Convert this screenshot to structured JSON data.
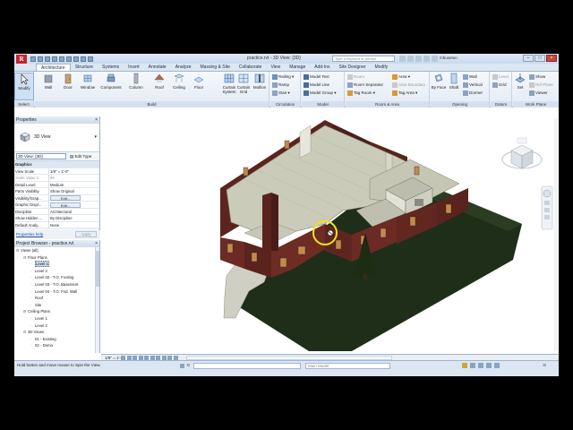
{
  "window": {
    "title": "practice.rvt - 3D View: {3D}",
    "search_placeholder": "Type a keyword or phrase",
    "user": "mhuseton",
    "app_logo": "R"
  },
  "ribbon_tabs": [
    "Architecture",
    "Structure",
    "Systems",
    "Insert",
    "Annotate",
    "Analyze",
    "Massing & Site",
    "Collaborate",
    "View",
    "Manage",
    "Add-Ins",
    "Site Designer",
    "Modify"
  ],
  "ribbon": {
    "modify": "Modify",
    "select_label": "Select",
    "build": [
      "Wall",
      "Door",
      "Window",
      "Component",
      "Column",
      "Roof",
      "Ceiling",
      "Floor"
    ],
    "curtain_system": "Curtain System",
    "curtain_grid": "Curtain Grid",
    "mullion": "Mullion",
    "build_label": "Build",
    "circulation": [
      "Railing",
      "Ramp",
      "Stair"
    ],
    "circulation_label": "Circulation",
    "model": [
      "Model Text",
      "Model Line",
      "Model Group"
    ],
    "model_label": "Model",
    "room": [
      "Room",
      "Room Separator",
      "Tag Room"
    ],
    "area": [
      "Area",
      "Area Boundary",
      "Tag Area"
    ],
    "room_label": "Room & Area",
    "opening_big": [
      "By Face",
      "Shaft"
    ],
    "opening_small": [
      "Wall",
      "Vertical",
      "Dormer"
    ],
    "opening_label": "Opening",
    "datum": [
      "Level",
      "Grid"
    ],
    "datum_label": "Datum",
    "set": "Set",
    "workplane_small": [
      "Show",
      "Ref Plane",
      "Viewer"
    ],
    "workplane_label": "Work Plane"
  },
  "properties": {
    "title": "Properties",
    "type_name": "3D View",
    "instance": "3D View: {3D}",
    "edit_type": "Edit Type",
    "rows": [
      {
        "k": "Graphics",
        "v": "",
        "cat": true
      },
      {
        "k": "View Scale",
        "v": "1/8\" = 1'-0\""
      },
      {
        "k": "Scale Value 1:",
        "v": "96",
        "dim": true
      },
      {
        "k": "Detail Level",
        "v": "Medium"
      },
      {
        "k": "Parts Visibility",
        "v": "Show Original"
      },
      {
        "k": "Visibility/Grap...",
        "v": "Edit...",
        "btn": true
      },
      {
        "k": "Graphic Displ...",
        "v": "Edit...",
        "btn": true
      },
      {
        "k": "Discipline",
        "v": "Architectural"
      },
      {
        "k": "Show Hidden ...",
        "v": "By Discipline"
      },
      {
        "k": "Default Analy...",
        "v": "None"
      }
    ],
    "help": "Properties help",
    "apply": "Apply"
  },
  "browser": {
    "title": "Project Browser - practice.rvt",
    "items": [
      {
        "t": "Views (all)",
        "lvl": 0,
        "tg": "⊟"
      },
      {
        "t": "Floor Plans",
        "lvl": 1,
        "tg": "⊟"
      },
      {
        "t": "Level 1",
        "lvl": 2,
        "sel": true
      },
      {
        "t": "Level 2",
        "lvl": 2
      },
      {
        "t": "Level 02 - T.O. Footing",
        "lvl": 2
      },
      {
        "t": "Level 03 - T.O. Basement",
        "lvl": 2
      },
      {
        "t": "Level 04 - T.O. Fnd. Wall",
        "lvl": 2
      },
      {
        "t": "Roof",
        "lvl": 2
      },
      {
        "t": "Site",
        "lvl": 2
      },
      {
        "t": "Ceiling Plans",
        "lvl": 1,
        "tg": "⊟"
      },
      {
        "t": "Level 1",
        "lvl": 2
      },
      {
        "t": "Level 2",
        "lvl": 2
      },
      {
        "t": "3D Views",
        "lvl": 1,
        "tg": "⊟"
      },
      {
        "t": "01 - Existing",
        "lvl": 2
      },
      {
        "t": "02 - Demo",
        "lvl": 2
      }
    ]
  },
  "viewbar": {
    "scale": "1/8\" = 1'-0\""
  },
  "status": {
    "text": "Hold button and move mouse to Spin the View.",
    "workset": ":0",
    "model": "Main Model",
    "filter_count": ":0"
  },
  "colors": {
    "brick": "#6b2b24",
    "floor": "#cfcfbf",
    "grass": "#24341c",
    "walkway": "#cfcfc4",
    "ribbon": "#dce7f4"
  }
}
